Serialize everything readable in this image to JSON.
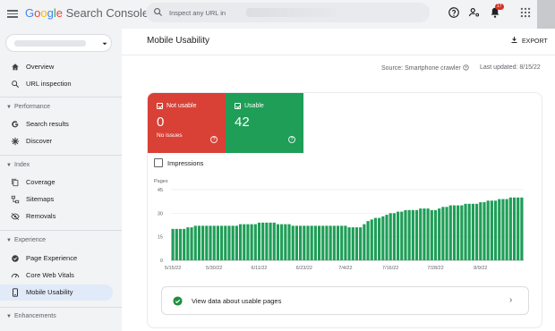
{
  "app": {
    "logo_letters": [
      "G",
      "o",
      "o",
      "g",
      "l",
      "e"
    ],
    "product_name": "Search Console"
  },
  "search": {
    "placeholder": "Inspect any URL in"
  },
  "notifications": {
    "count": "17"
  },
  "sidebar": {
    "items_top": [
      {
        "label": "Overview",
        "icon": "home-icon"
      },
      {
        "label": "URL inspection",
        "icon": "search-icon"
      }
    ],
    "sections": [
      {
        "header": "Performance",
        "items": [
          {
            "label": "Search results",
            "icon": "google-g-icon"
          },
          {
            "label": "Discover",
            "icon": "asterisk-icon"
          }
        ]
      },
      {
        "header": "Index",
        "items": [
          {
            "label": "Coverage",
            "icon": "file-copy-icon"
          },
          {
            "label": "Sitemaps",
            "icon": "sitemap-icon"
          },
          {
            "label": "Removals",
            "icon": "removals-icon"
          }
        ]
      },
      {
        "header": "Experience",
        "items": [
          {
            "label": "Page Experience",
            "icon": "experience-icon"
          },
          {
            "label": "Core Web Vitals",
            "icon": "gauge-icon"
          },
          {
            "label": "Mobile Usability",
            "icon": "phone-icon",
            "active": true
          }
        ]
      },
      {
        "header": "Enhancements",
        "items": []
      }
    ]
  },
  "main": {
    "title": "Mobile Usability",
    "export_label": "EXPORT",
    "source": "Source: Smartphone crawler",
    "last_updated": "Last updated: 8/15/22",
    "tiles": {
      "not_usable": {
        "label": "Not usable",
        "value": "0",
        "sub": "No issues",
        "color": "#d94136"
      },
      "usable": {
        "label": "Usable",
        "value": "42",
        "color": "#1e9e57"
      }
    },
    "impressions_label": "Impressions",
    "link_text": "View data about usable pages"
  },
  "chart_data": {
    "type": "bar",
    "ylabel": "Pages",
    "ylim": [
      0,
      45
    ],
    "yticks": [
      "0",
      "15",
      "30",
      "45"
    ],
    "xticks": [
      "5/15/22",
      "5/30/22",
      "6/11/22",
      "6/23/22",
      "7/4/22",
      "7/16/22",
      "7/28/22",
      "8/9/22"
    ],
    "xtick_positions": [
      0,
      11,
      23,
      35,
      46,
      58,
      70,
      82
    ],
    "color": "#1e9e57",
    "series": [
      {
        "values": [
          20,
          20,
          20,
          20,
          21,
          21,
          22,
          22,
          22,
          22,
          22,
          22,
          22,
          22,
          22,
          22,
          22,
          22,
          23,
          23,
          23,
          23,
          23,
          24,
          24,
          24,
          24,
          24,
          23,
          23,
          23,
          23,
          22,
          22,
          22,
          22,
          22,
          22,
          22,
          22,
          22,
          22,
          22,
          22,
          22,
          22,
          22,
          21,
          21,
          21,
          21,
          23,
          25,
          26,
          27,
          27,
          28,
          29,
          30,
          30,
          31,
          31,
          32,
          32,
          32,
          32,
          33,
          33,
          33,
          32,
          32,
          33,
          34,
          34,
          35,
          35,
          35,
          35,
          36,
          36,
          36,
          36,
          37,
          37,
          38,
          38,
          38,
          39,
          39,
          39,
          40,
          40,
          40,
          40
        ]
      }
    ]
  }
}
